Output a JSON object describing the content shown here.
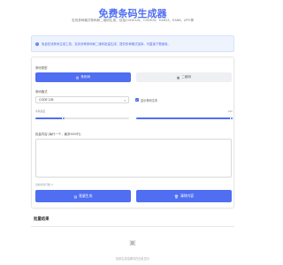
{
  "header": {
    "title": "免费条码生成器",
    "subtitle": "支持多种格式条码和二维码生成，包括CODE128、CODE39、EAN13、EAN8、UPC等"
  },
  "notice": {
    "icon": "info-icon",
    "text": "免费在线条码生成工具，支持多种条码和二维码批量生成，提供多种格式选择，可直接下载使用。"
  },
  "form": {
    "type_label": "条码类型",
    "type_options": [
      {
        "label": "条形码",
        "icon": "barcode-icon",
        "selected": true
      },
      {
        "label": "二维码",
        "icon": "qrcode-icon",
        "selected": false
      }
    ],
    "format_label": "条码格式",
    "format_value": "CODE 128",
    "show_text_label": "显示条码文本",
    "show_text_checked": true,
    "slider1_label": "条码宽度",
    "slider1_value": 0.3,
    "slider2_value_label": "100",
    "slider2_value": 1.0,
    "content_label": "批量内容 (每行一个，最多2000行)",
    "hint": "当前条码行数: 0",
    "generate_label": "批量生成",
    "clear_label": "清除内容"
  },
  "results": {
    "title": "批量结果",
    "empty_icon": "image-placeholder-icon",
    "empty_text": "批量生成结果将在此处显示"
  },
  "colors": {
    "accent": "#4f6ef2",
    "notice_bg": "#eef3fe"
  }
}
